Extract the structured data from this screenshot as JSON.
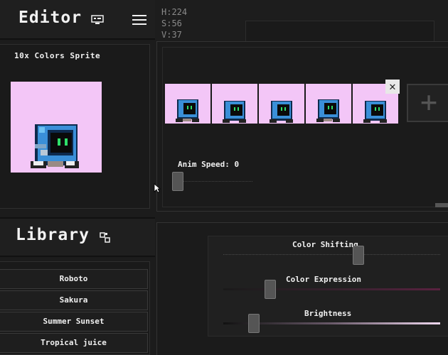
{
  "editor": {
    "title": "Editor"
  },
  "hsv": {
    "h": "H:224",
    "s": "S:56",
    "v": "V:37"
  },
  "sprite": {
    "title": "10x Colors Sprite"
  },
  "animation": {
    "speed_label": "Anim Speed: 0",
    "speed_value": 0,
    "frame_count": 5
  },
  "library": {
    "title": "Library",
    "items": [
      "Roboto",
      "Sakura",
      "Summer Sunset",
      "Tropical juice"
    ]
  },
  "color_controls": {
    "shift_label": "Color Shifting",
    "expression_label": "Color Expression",
    "brightness_label": "Brightness"
  },
  "colors": {
    "sprite_bg": "#f3c6f7",
    "robot_blue": "#3a8fd8",
    "robot_dark": "#0e2a4d"
  }
}
